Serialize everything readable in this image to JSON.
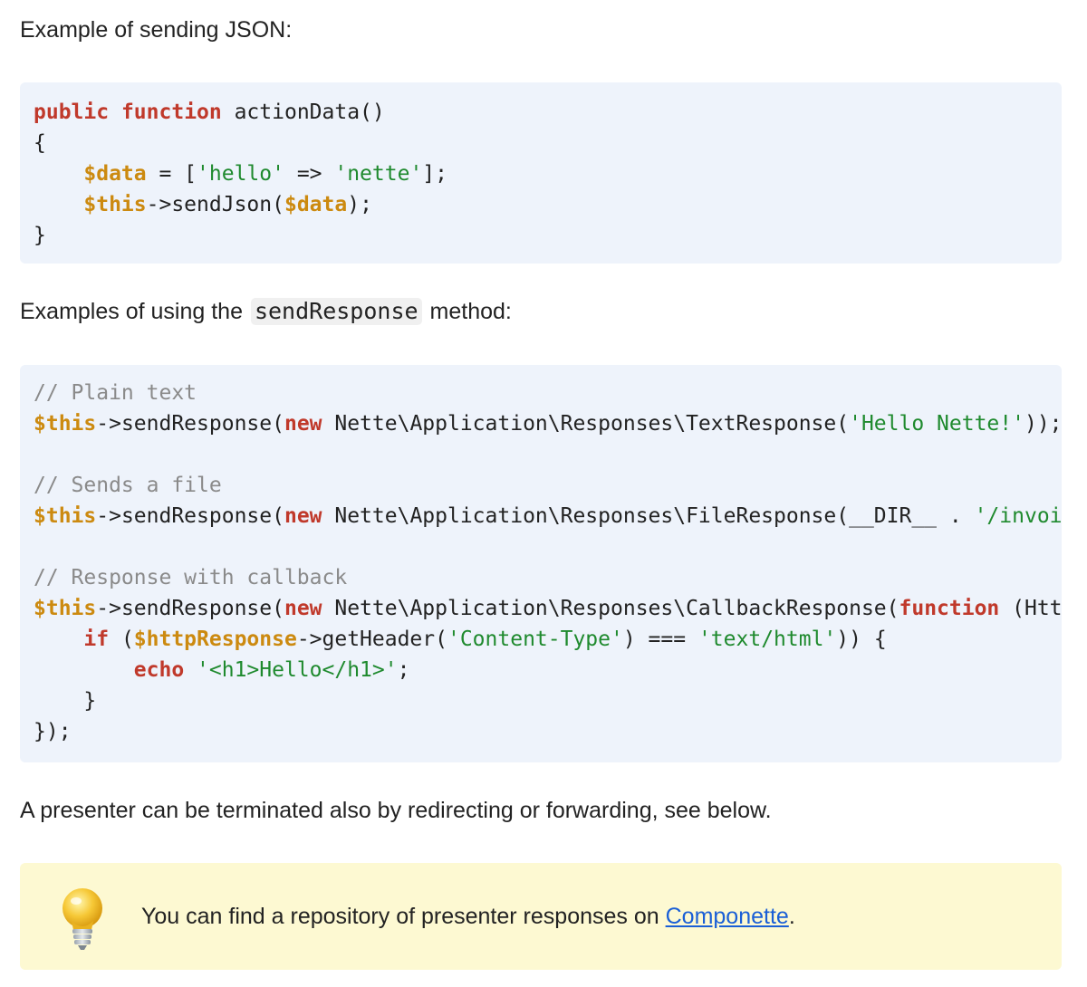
{
  "intro_json": "Example of sending JSON:",
  "code_json": {
    "lines": [
      [
        {
          "t": "public",
          "c": "kw"
        },
        {
          "t": " "
        },
        {
          "t": "function",
          "c": "kw"
        },
        {
          "t": " actionData()"
        }
      ],
      [
        {
          "t": "{"
        }
      ],
      [
        {
          "t": "    "
        },
        {
          "t": "$data",
          "c": "var"
        },
        {
          "t": " = ["
        },
        {
          "t": "'hello'",
          "c": "str"
        },
        {
          "t": " => "
        },
        {
          "t": "'nette'",
          "c": "str"
        },
        {
          "t": "];"
        }
      ],
      [
        {
          "t": "    "
        },
        {
          "t": "$this",
          "c": "var"
        },
        {
          "t": "->sendJson("
        },
        {
          "t": "$data",
          "c": "var"
        },
        {
          "t": ");"
        }
      ],
      [
        {
          "t": "}"
        }
      ]
    ]
  },
  "intro_response": {
    "before": "Examples of using the",
    "code": "sendResponse",
    "after": "method:"
  },
  "code_response": {
    "lines": [
      [
        {
          "t": "// Plain text",
          "c": "cmt"
        }
      ],
      [
        {
          "t": "$this",
          "c": "var"
        },
        {
          "t": "->sendResponse("
        },
        {
          "t": "new",
          "c": "kw"
        },
        {
          "t": " Nette\\Application\\Responses\\TextResponse("
        },
        {
          "t": "'Hello Nette!'",
          "c": "str"
        },
        {
          "t": "));"
        }
      ],
      [],
      [
        {
          "t": "// Sends a file",
          "c": "cmt"
        }
      ],
      [
        {
          "t": "$this",
          "c": "var"
        },
        {
          "t": "->sendResponse("
        },
        {
          "t": "new",
          "c": "kw"
        },
        {
          "t": " Nette\\Application\\Responses\\FileResponse(__DIR__ . "
        },
        {
          "t": "'/invoice.",
          "c": "str"
        }
      ],
      [],
      [
        {
          "t": "// Response with callback",
          "c": "cmt"
        }
      ],
      [
        {
          "t": "$this",
          "c": "var"
        },
        {
          "t": "->sendResponse("
        },
        {
          "t": "new",
          "c": "kw"
        },
        {
          "t": " Nette\\Application\\Responses\\CallbackResponse("
        },
        {
          "t": "function",
          "c": "kw"
        },
        {
          "t": " (Http\\I"
        }
      ],
      [
        {
          "t": "    "
        },
        {
          "t": "if",
          "c": "kw"
        },
        {
          "t": " ("
        },
        {
          "t": "$httpResponse",
          "c": "var"
        },
        {
          "t": "->getHeader("
        },
        {
          "t": "'Content-Type'",
          "c": "str"
        },
        {
          "t": ") === "
        },
        {
          "t": "'text/html'",
          "c": "str"
        },
        {
          "t": ")) {"
        }
      ],
      [
        {
          "t": "        "
        },
        {
          "t": "echo",
          "c": "kw"
        },
        {
          "t": " "
        },
        {
          "t": "'<h1>Hello</h1>'",
          "c": "str"
        },
        {
          "t": ";"
        }
      ],
      [
        {
          "t": "    }"
        }
      ],
      [
        {
          "t": "});"
        }
      ]
    ]
  },
  "terminate_text": "A presenter can be terminated also by redirecting or forwarding, see below.",
  "tip": {
    "icon": "lightbulb-icon",
    "text_before": "You can find a repository of presenter responses on ",
    "link_text": "Componette",
    "text_after": "."
  },
  "colors": {
    "code_bg": "#eef3fb",
    "keyword": "#c0392b",
    "variable": "#cc8a10",
    "string": "#1f8a2e",
    "comment": "#8a8a8a",
    "tip_bg": "#fdf9d2",
    "link": "#1a5fd6"
  }
}
